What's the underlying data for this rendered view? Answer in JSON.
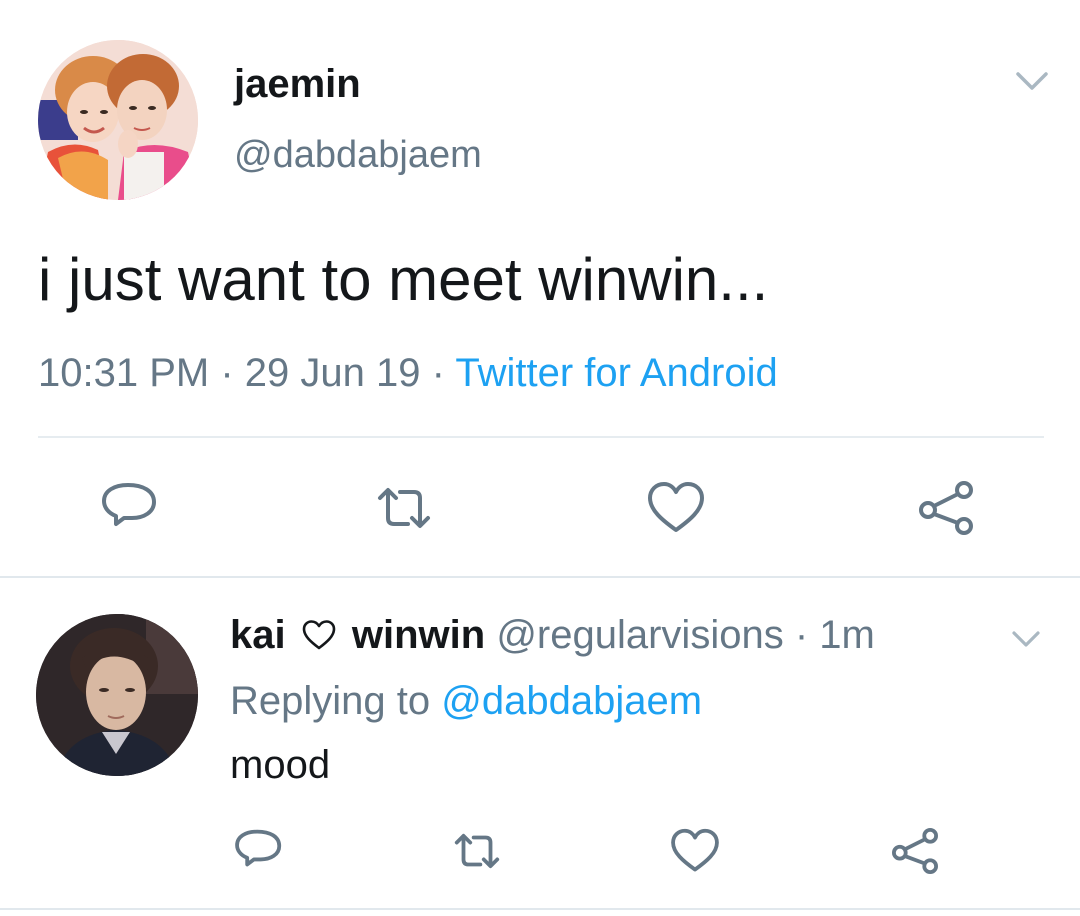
{
  "main_tweet": {
    "author_name": "jaemin",
    "author_handle": "@dabdabjaem",
    "text": "i just want to meet winwin...",
    "time": "10:31 PM",
    "date": "29 Jun 19",
    "separator": "·",
    "source": "Twitter for Android",
    "actions": [
      "reply-icon",
      "retweet-icon",
      "like-icon",
      "share-icon"
    ]
  },
  "reply_tweet": {
    "author_name_part1": "kai",
    "author_name_part2": "winwin",
    "author_handle": "@regularvisions",
    "separator": "·",
    "time_ago": "1m",
    "replying_prefix": "Replying to",
    "replying_to": "@dabdabjaem",
    "text": "mood",
    "actions": [
      "reply-icon",
      "retweet-icon",
      "like-icon",
      "share-icon"
    ]
  },
  "colors": {
    "text": "#14171a",
    "secondary": "#657786",
    "link": "#1da1f2",
    "icon": "#657786",
    "divider": "#e1e8ed"
  }
}
